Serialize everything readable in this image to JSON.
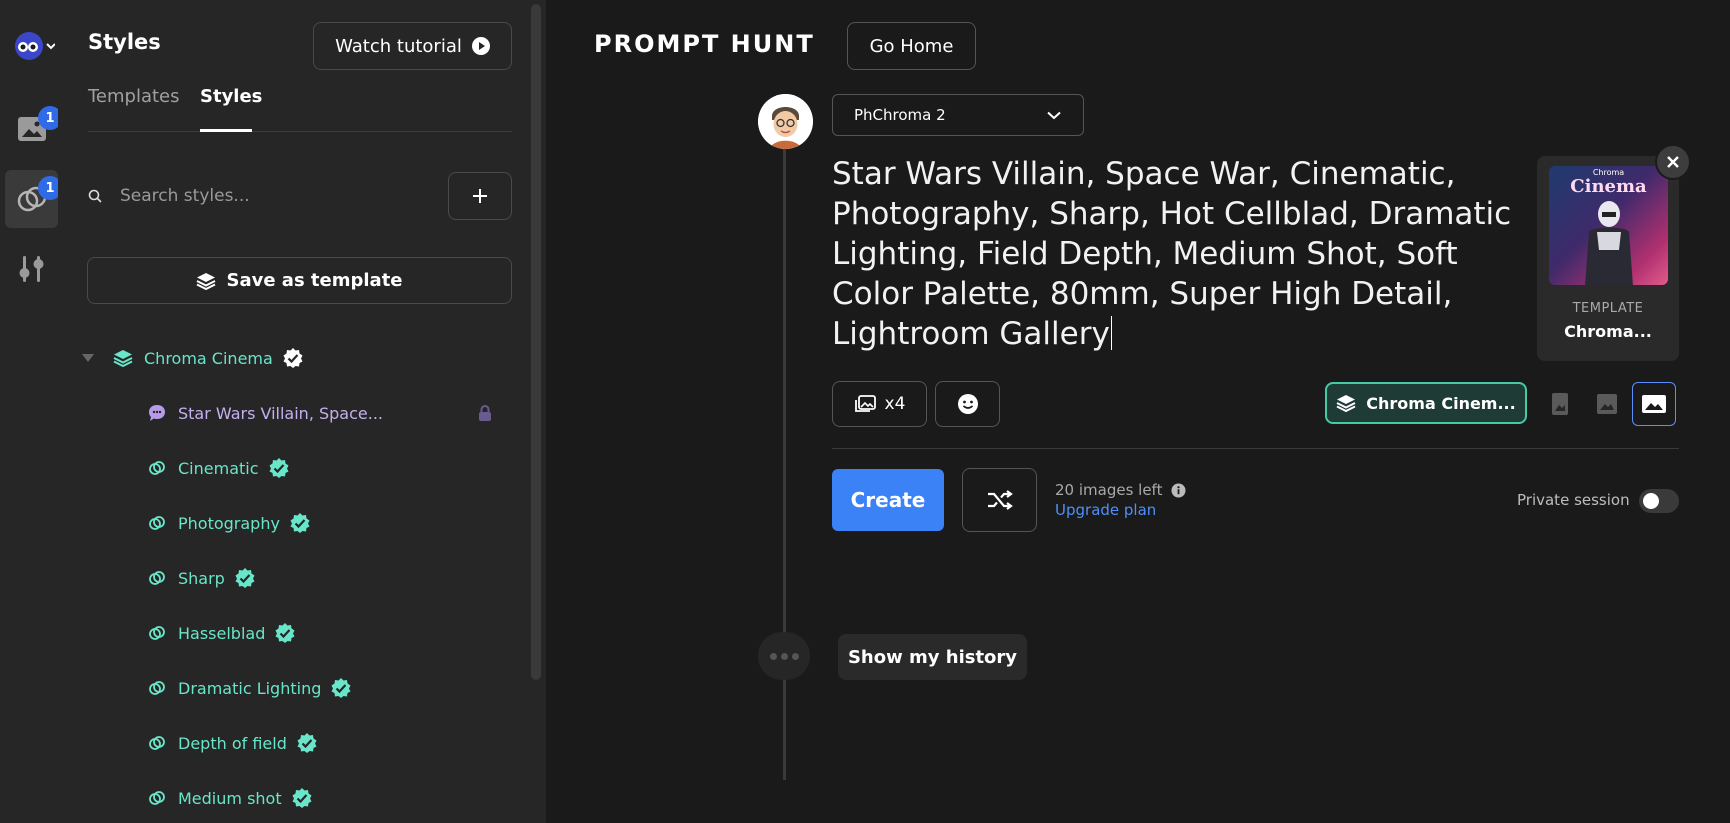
{
  "rail": {
    "gallery_badge": "1",
    "styles_badge": "1"
  },
  "panel": {
    "title": "Styles",
    "watch_tutorial": "Watch tutorial",
    "tabs": [
      {
        "label": "Templates",
        "active": false
      },
      {
        "label": "Styles",
        "active": true
      }
    ],
    "search_placeholder": "Search styles...",
    "save_as_template": "Save as template",
    "tree": {
      "root_label": "Chroma Cinema",
      "items": [
        {
          "label": "Star Wars Villain, Space...",
          "kind": "prompt",
          "locked": true
        },
        {
          "label": "Cinematic",
          "kind": "style",
          "verified": true
        },
        {
          "label": "Photography",
          "kind": "style",
          "verified": true
        },
        {
          "label": "Sharp",
          "kind": "style",
          "verified": true
        },
        {
          "label": "Hasselblad",
          "kind": "style",
          "verified": true
        },
        {
          "label": "Dramatic Lighting",
          "kind": "style",
          "verified": true
        },
        {
          "label": "Depth of field",
          "kind": "style",
          "verified": true
        },
        {
          "label": "Medium shot",
          "kind": "style",
          "verified": true
        }
      ]
    }
  },
  "main": {
    "logo": "PROMPT HUNT",
    "go_home": "Go Home",
    "model": "PhChroma 2",
    "prompt": "Star Wars Villain, Space War, Cinematic, Photography, Sharp, Hot Cellblad, Dramatic Lighting, Field Depth, Medium Shot, Soft Color Palette, 80mm, Super High Detail, Lightroom Gallery",
    "template_card": {
      "image_sub": "Chroma",
      "image_title": "Cinema",
      "label": "TEMPLATE",
      "name": "Chroma..."
    },
    "count_label": "x4",
    "style_chip": "Chroma Cinem...",
    "create": "Create",
    "images_left": "20 images left",
    "upgrade_plan": "Upgrade plan",
    "private_session": "Private session",
    "show_history": "Show my history"
  },
  "colors": {
    "accent_teal": "#69e6c9",
    "prompt_purple": "#c3b0ef",
    "primary_blue": "#3b82f6",
    "link_blue": "#4f8ff7"
  }
}
